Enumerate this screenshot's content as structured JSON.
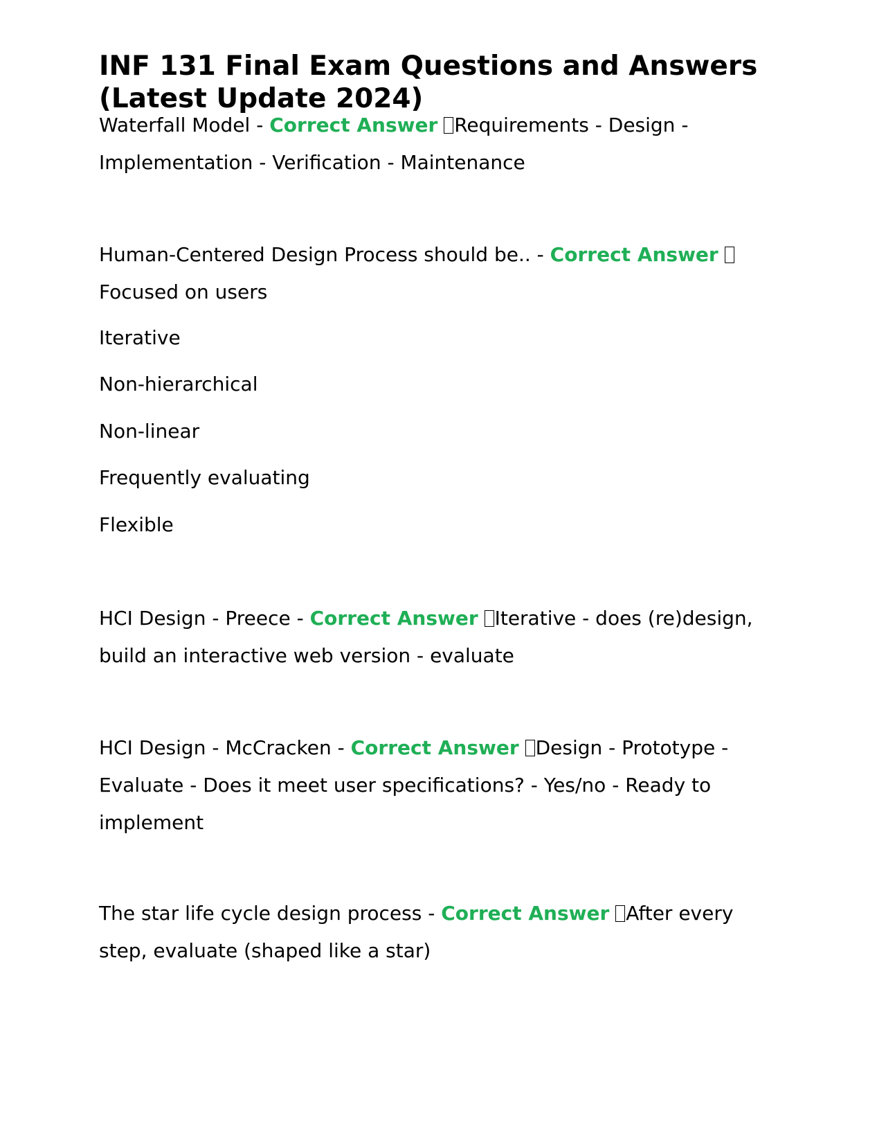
{
  "document": {
    "title": "INF 131 Final Exam Questions and Answers (Latest Update 2024)",
    "answer_label": "Correct Answer",
    "accent_color": "#1faf56",
    "qa": [
      {
        "question": "Waterfall Model - ",
        "answer": "Requirements - Design - Implementation - Verification - Maintenance"
      },
      {
        "question": "Human-Centered Design Process should be.. - ",
        "answer": "Focused on users",
        "list": [
          "Iterative",
          "Non-hierarchical",
          "Non-linear",
          "Frequently evaluating",
          "Flexible"
        ]
      },
      {
        "question": "HCI Design - Preece - ",
        "answer": "Iterative - does (re)design, build an interactive web version - evaluate"
      },
      {
        "question": "HCI Design - McCracken - ",
        "answer": "Design - Prototype - Evaluate - Does it meet user specifications? - Yes/no - Ready to implement"
      },
      {
        "question": "The star life cycle design process - ",
        "answer": "After every step, evaluate (shaped like a star)"
      }
    ]
  }
}
